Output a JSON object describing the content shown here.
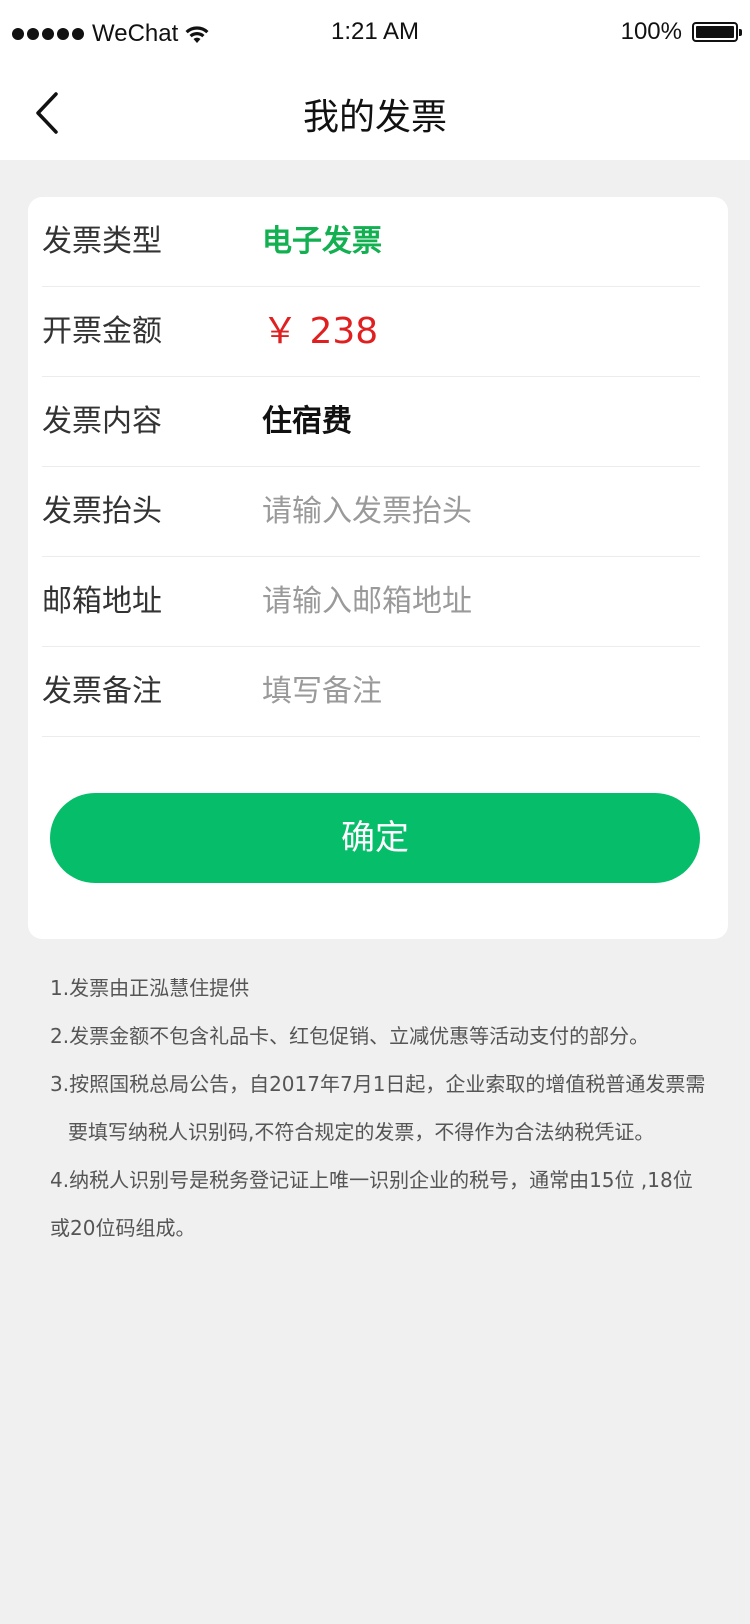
{
  "status_bar": {
    "carrier": "WeChat",
    "time": "1:21 AM",
    "battery": "100%",
    "battery_level": 1.0
  },
  "nav": {
    "title": "我的发票",
    "back_icon": "chevron-left-icon"
  },
  "form": {
    "rows": [
      {
        "label": "发票类型",
        "value": "电子发票"
      },
      {
        "label": "开票金额",
        "value": "￥ 238"
      },
      {
        "label": "发票内容",
        "value": "住宿费"
      },
      {
        "label": "发票抬头",
        "placeholder": "请输入发票抬头"
      },
      {
        "label": "邮箱地址",
        "placeholder": "请输入邮箱地址"
      },
      {
        "label": "发票备注",
        "placeholder": "填写备注"
      }
    ],
    "confirm_label": "确定"
  },
  "notes": [
    "1.发票由正泓慧住提供",
    "2.发票金额不包含礼品卡、红包促销、立减优惠等活动支付的部分。",
    "3.按照国税总局公告，自2017年7月1日起，企业索取的增值税普通发票需",
    "要填写纳税人识别码,不符合规定的发票，不得作为合法纳税凭证。",
    "4.纳税人识别号是税务登记证上唯一识别企业的税号，通常由15位 ,18位",
    "或20位码组成。"
  ],
  "colors": {
    "accent": "#06be6a",
    "invoice_type": "#12b050",
    "amount": "#e02020",
    "background": "#f0f0f0"
  }
}
